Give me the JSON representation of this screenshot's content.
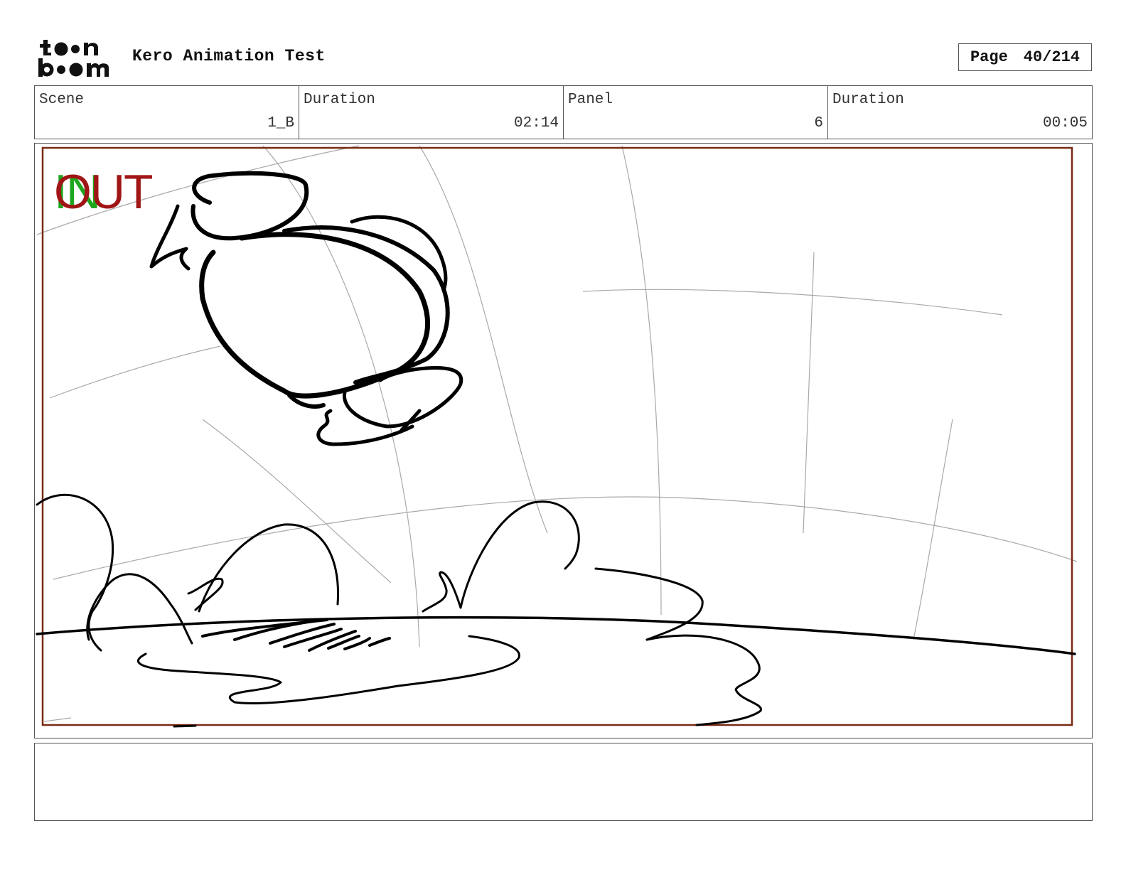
{
  "header": {
    "logo": {
      "icon": "toon-boom-logo",
      "text": "toon boom"
    },
    "project_title": "Kero Animation Test",
    "page_label": "Page",
    "page_value": "40/214"
  },
  "info": [
    {
      "label": "Scene",
      "value": "1_B"
    },
    {
      "label": "Duration",
      "value": "02:14"
    },
    {
      "label": "Panel",
      "value": "6"
    },
    {
      "label": "Duration",
      "value": "00:05"
    }
  ],
  "panel": {
    "in_label": "IN",
    "out_label": "OUT",
    "in_color": "#1ea61e",
    "out_color": "#a01616",
    "safe_frame_color": "#7a2a12"
  },
  "caption": {
    "text": ""
  }
}
